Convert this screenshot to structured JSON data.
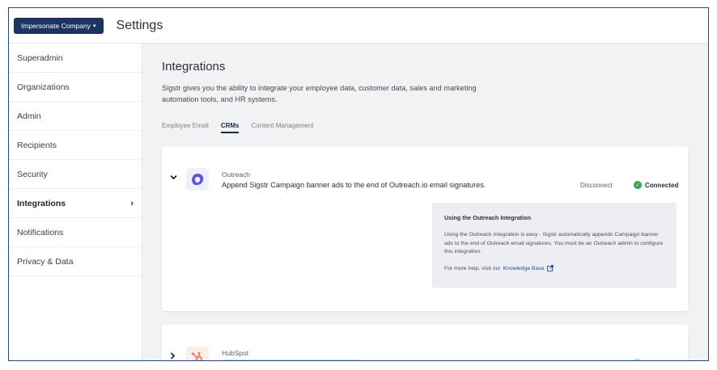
{
  "header": {
    "impersonate_label": "Impersonate Company",
    "impersonate_caret": "▾",
    "title": "Settings"
  },
  "sidebar": {
    "items": [
      {
        "label": "Superadmin"
      },
      {
        "label": "Organizations"
      },
      {
        "label": "Admin"
      },
      {
        "label": "Recipients"
      },
      {
        "label": "Security"
      },
      {
        "label": "Integrations",
        "chevron": "›"
      },
      {
        "label": "Notifications"
      },
      {
        "label": "Privacy & Data"
      }
    ],
    "active_index": 5
  },
  "main": {
    "title": "Integrations",
    "description": "Sigstr gives you the ability to integrate your employee data, customer data, sales and marketing automation tools, and HR systems.",
    "tabs": [
      {
        "label": "Employee Email"
      },
      {
        "label": "CRMs"
      },
      {
        "label": "Content Management"
      }
    ],
    "active_tab": 1
  },
  "integrations": [
    {
      "name": "Outreach",
      "description": "Append Sigstr Campaign banner ads to the end of Outreach.io email signatures.",
      "disconnect_label": "Disconnect",
      "status": "Connected",
      "expanded": true,
      "info": {
        "title": "Using the Outreach Integration",
        "body": "Using the Outreach Integration is easy - Sigstr automatically appends Campaign banner ads to the end of Outreach email signatures. You must be an Outreach admin to configure this integration.",
        "help_prefix": "For more help, visit our",
        "help_link": "Knowledge Base"
      }
    },
    {
      "name": "HubSpot",
      "expanded": false
    }
  ],
  "colors": {
    "brand_navy": "#1c3461",
    "border_blue": "#2a4d7a",
    "connected_green": "#2fa84f",
    "outreach_blue": "#5951ff",
    "hubspot_orange": "#ff7a59",
    "main_bg": "#f1f2f4"
  },
  "icons": {
    "expand_open": "chevron-down-icon",
    "expand_closed": "chevron-right-icon",
    "connected": "check-circle-icon",
    "external_link": "external-link-icon"
  }
}
